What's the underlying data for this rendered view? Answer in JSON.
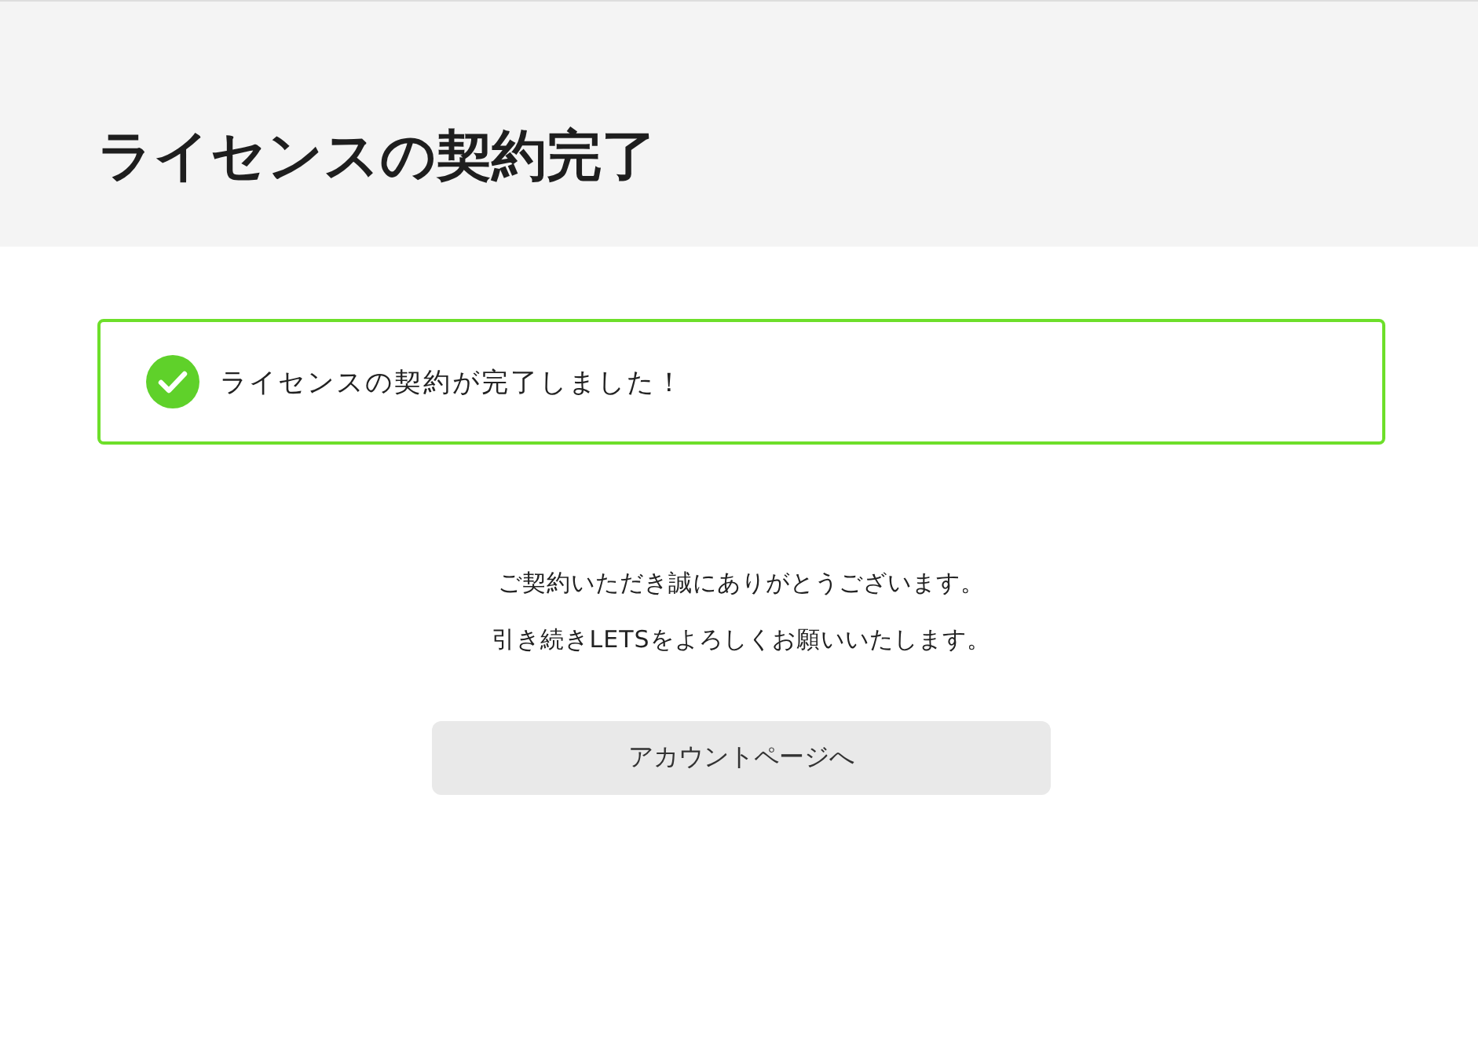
{
  "header": {
    "title": "ライセンスの契約完了"
  },
  "alert": {
    "message": "ライセンスの契約が完了しました！"
  },
  "messages": [
    "ご契約いただき誠にありがとうございます。",
    "引き続きLETSをよろしくお願いいたします。"
  ],
  "button": {
    "label": "アカウントページへ"
  }
}
